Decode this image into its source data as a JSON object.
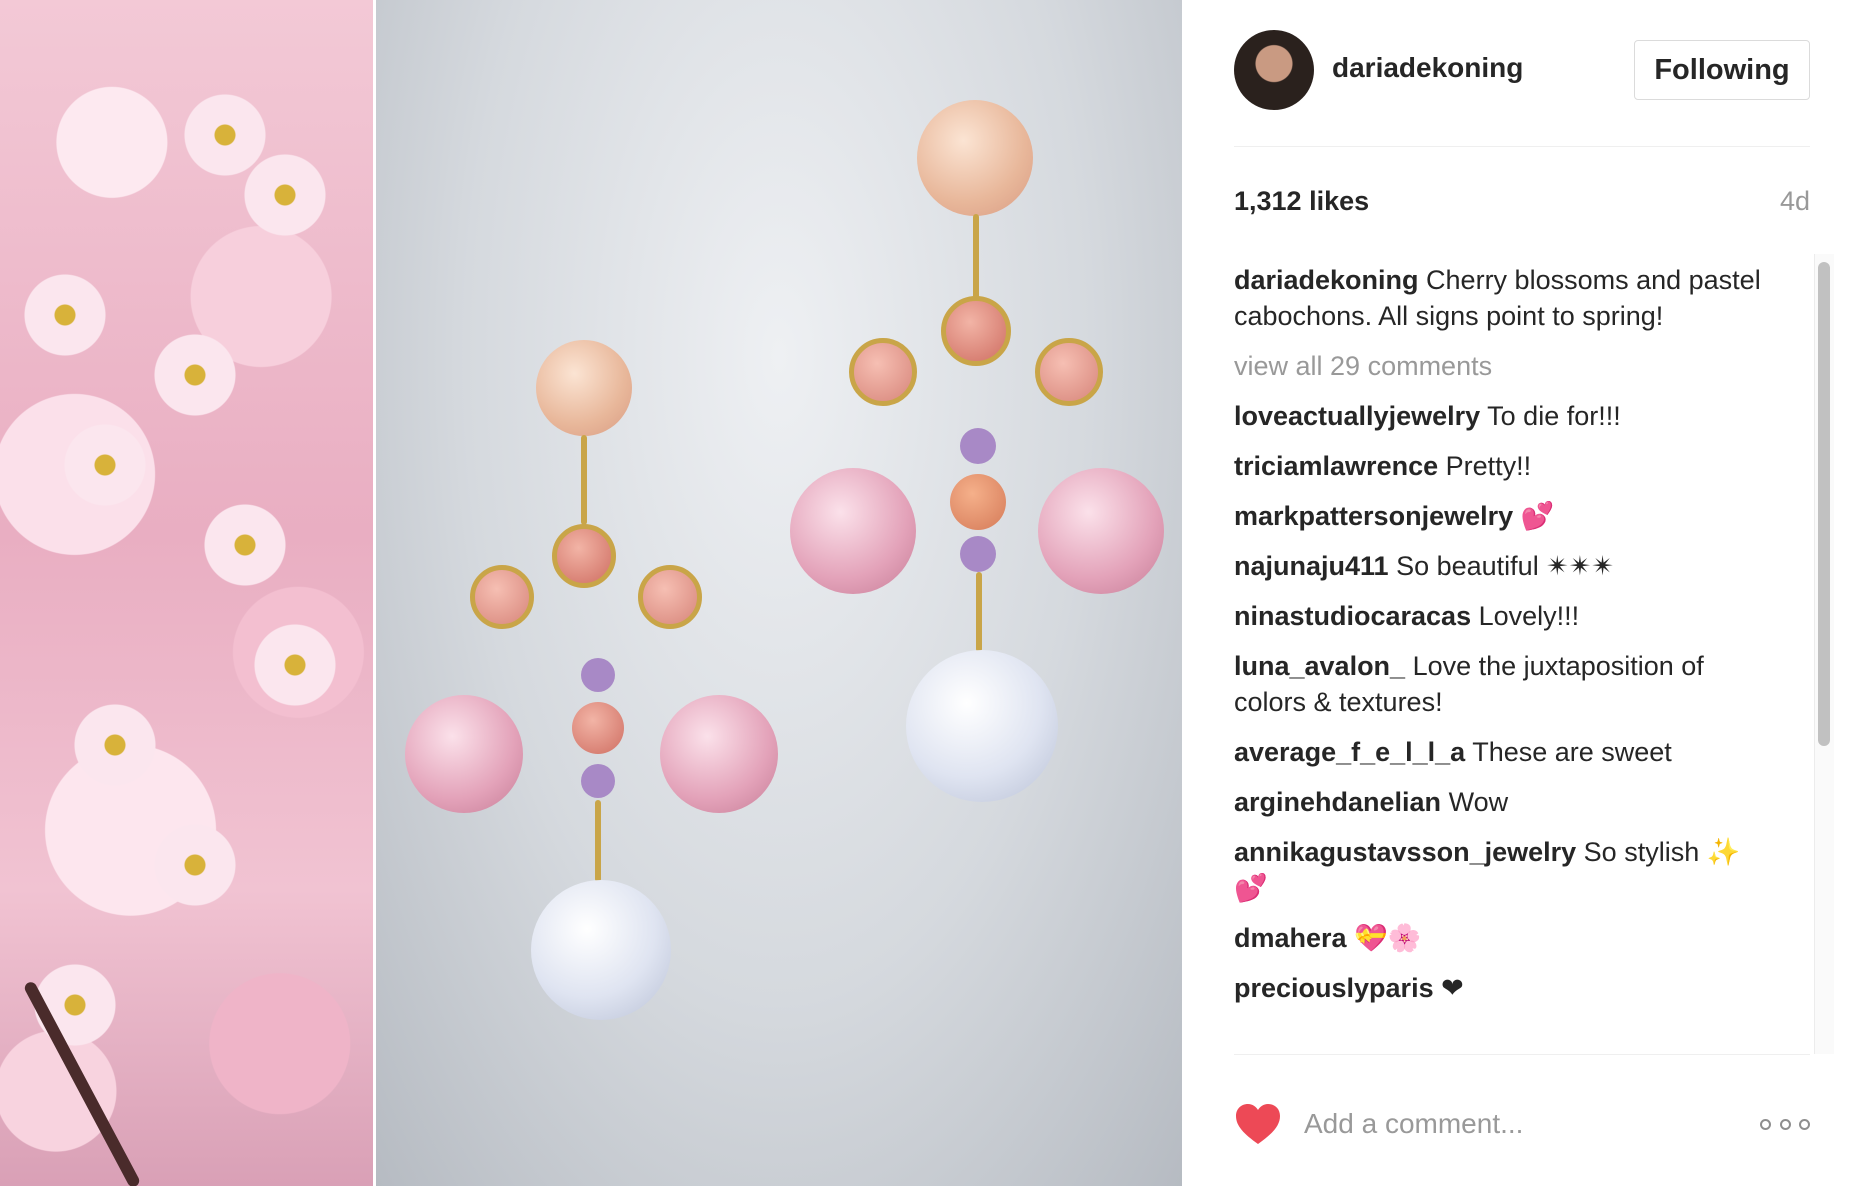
{
  "post": {
    "photo_description_icon": "image"
  },
  "header": {
    "username": "dariadekoning",
    "follow_label": "Following"
  },
  "stats": {
    "likes": "1,312 likes",
    "age": "4d"
  },
  "caption": {
    "username": "dariadekoning",
    "text": "Cherry blossoms and pastel cabochons. All signs point to spring!"
  },
  "view_all": "view all 29 comments",
  "comments": [
    {
      "username": "loveactuallyjewelry",
      "text": "To die for!!!"
    },
    {
      "username": "triciamlawrence",
      "text": "Pretty!!"
    },
    {
      "username": "markpattersonjewelry",
      "text": "💕"
    },
    {
      "username": "najunaju411",
      "text": "So beautiful ✴✴✴"
    },
    {
      "username": "ninastudiocaracas",
      "text": "Lovely!!!"
    },
    {
      "username": "luna_avalon_",
      "text": "Love the juxtaposition of colors & textures!"
    },
    {
      "username": "average_f_e_l_l_a",
      "text": "These are sweet"
    },
    {
      "username": "arginehdanelian",
      "text": "Wow"
    },
    {
      "username": "annikagustavsson_jewelry",
      "text": "So stylish ✨ 💕"
    },
    {
      "username": "dmahera",
      "text": "💝🌸"
    },
    {
      "username": "preciouslyparis",
      "text": "❤"
    }
  ],
  "footer": {
    "comment_placeholder": "Add a comment...",
    "heart_icon": "heart-icon",
    "more_icon": "more-options-icon"
  },
  "colors": {
    "like_red": "#ed4956",
    "text_dark": "#262626",
    "text_muted": "#999999"
  }
}
